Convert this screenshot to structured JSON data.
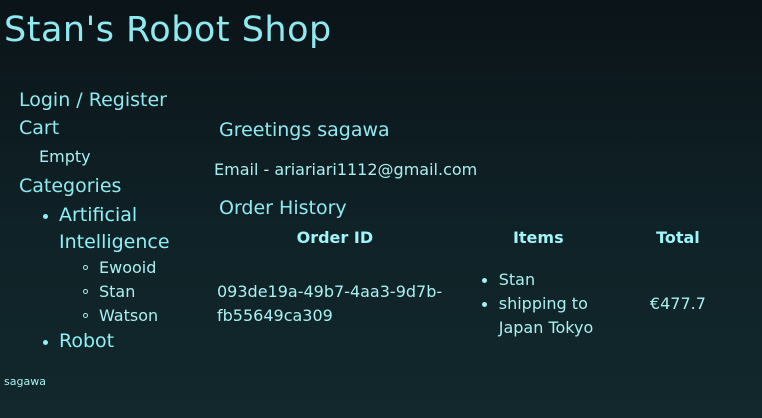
{
  "header": {
    "title": "Stan's Robot Shop"
  },
  "sidebar": {
    "login_label": "Login / Register",
    "cart_label": "Cart",
    "cart_status": "Empty",
    "categories_label": "Categories",
    "categories": [
      {
        "label": "Artificial Intelligence",
        "products": [
          "Ewooid",
          "Stan",
          "Watson"
        ]
      },
      {
        "label": "Robot",
        "products": []
      }
    ]
  },
  "main": {
    "greeting": "Greetings sagawa",
    "email_line": "Email - ariariari1112@gmail.com",
    "order_history_label": "Order History",
    "orders_table": {
      "headers": [
        "Order ID",
        "Items",
        "Total"
      ],
      "rows": [
        {
          "order_id": "093de19a-49b7-4aa3-9d7b-fb55649ca309",
          "items": [
            "Stan",
            "shipping to Japan Tokyo"
          ],
          "total": "€477.7"
        }
      ]
    }
  },
  "footer": {
    "username": "sagawa"
  }
}
